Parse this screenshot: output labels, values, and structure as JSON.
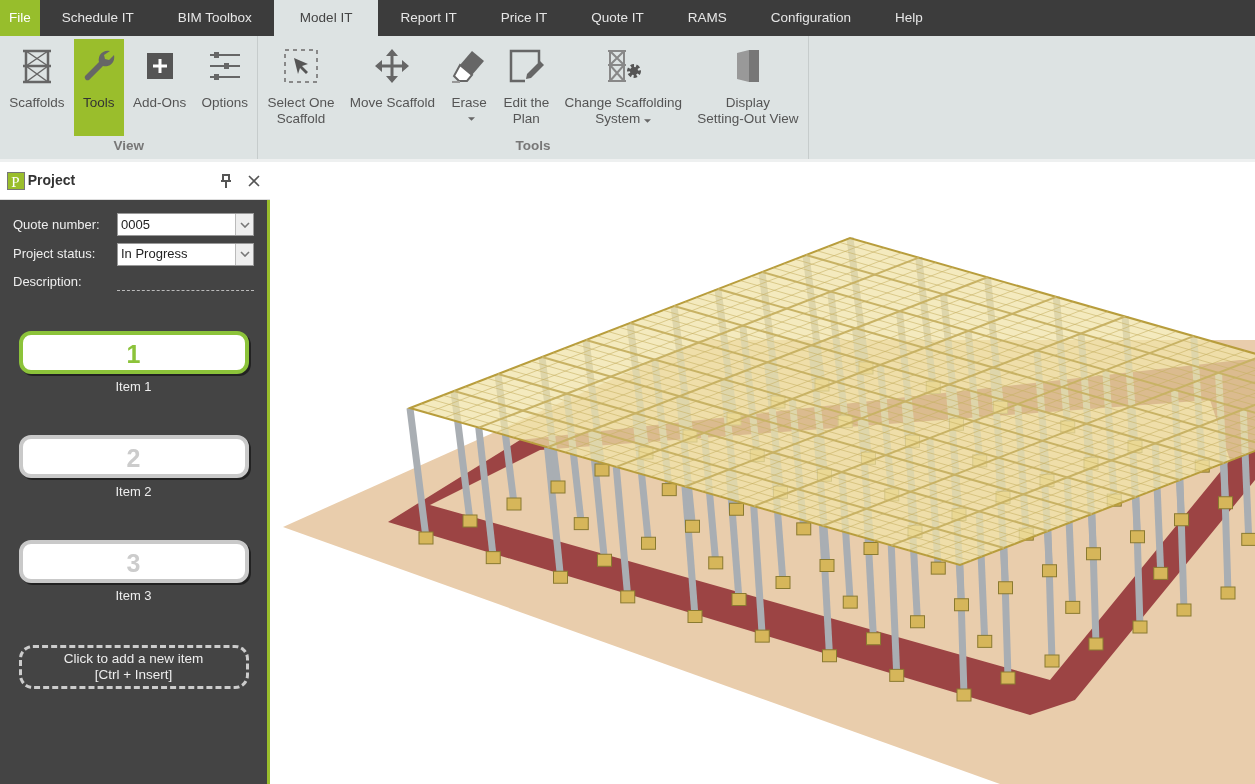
{
  "menu_tabs": [
    {
      "label": "File",
      "kind": "file",
      "selected": false
    },
    {
      "label": "Schedule IT",
      "kind": "tab",
      "selected": false
    },
    {
      "label": "BIM Toolbox",
      "kind": "tab",
      "selected": false
    },
    {
      "label": "Model IT",
      "kind": "tab",
      "selected": true
    },
    {
      "label": "Report IT",
      "kind": "tab",
      "selected": false
    },
    {
      "label": "Price IT",
      "kind": "tab",
      "selected": false
    },
    {
      "label": "Quote IT",
      "kind": "tab",
      "selected": false
    },
    {
      "label": "RAMS",
      "kind": "tab",
      "selected": false
    },
    {
      "label": "Configuration",
      "kind": "tab",
      "selected": false
    },
    {
      "label": "Help",
      "kind": "tab",
      "selected": false
    }
  ],
  "ribbon": {
    "groups": [
      {
        "title": "View",
        "buttons": [
          {
            "label": "Scaffolds",
            "selected": false,
            "dropdown": false
          },
          {
            "label": "Tools",
            "selected": true,
            "dropdown": false
          },
          {
            "label": "Add-Ons",
            "selected": false,
            "dropdown": false
          },
          {
            "label": "Options",
            "selected": false,
            "dropdown": false
          }
        ]
      },
      {
        "title": "Tools",
        "buttons": [
          {
            "label": "Select One\nScaffold",
            "selected": false,
            "dropdown": false
          },
          {
            "label": "Move Scaffold",
            "selected": false,
            "dropdown": false
          },
          {
            "label": "Erase",
            "selected": false,
            "dropdown": true
          },
          {
            "label": "Edit the\nPlan",
            "selected": false,
            "dropdown": false
          },
          {
            "label": "Change Scaffolding\nSystem",
            "selected": false,
            "dropdown": true
          },
          {
            "label": "Display\nSetting-Out View",
            "selected": false,
            "dropdown": false
          }
        ]
      }
    ]
  },
  "project_panel": {
    "logo": "P",
    "title": "Project",
    "fields": [
      {
        "kind": "combo",
        "label": "Quote number:",
        "value": "0005"
      },
      {
        "kind": "combo",
        "label": "Project status:",
        "value": "In Progress"
      },
      {
        "kind": "line",
        "label": "Description:"
      }
    ],
    "items": [
      {
        "number": "1",
        "label": "Item 1",
        "selected": true
      },
      {
        "number": "2",
        "label": "Item 2",
        "selected": false
      },
      {
        "number": "3",
        "label": "Item 3",
        "selected": false
      }
    ],
    "add_item": "Click to add a new item\n[Ctrl + Insert]"
  }
}
